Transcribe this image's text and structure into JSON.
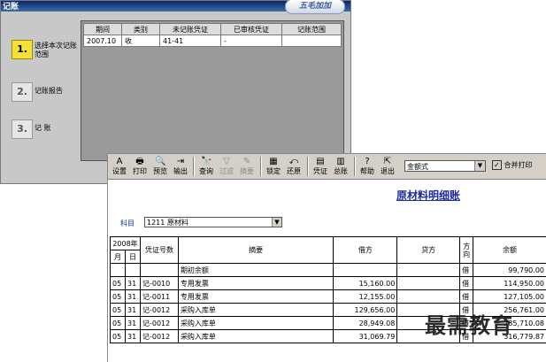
{
  "back_window": {
    "title": "记账",
    "logo_text": "五毛加加",
    "steps": [
      {
        "num": "1.",
        "label": "选择本次记账范围"
      },
      {
        "num": "2.",
        "label": "记账报告"
      },
      {
        "num": "3.",
        "label": "记    账"
      }
    ],
    "grid": {
      "headers": [
        "期间",
        "类别",
        "未记账凭证",
        "已审核凭证",
        "记账范围"
      ],
      "rows": [
        [
          "2007.10",
          "收",
          "41-41",
          "-",
          ""
        ]
      ]
    }
  },
  "toolbar": {
    "buttons": [
      {
        "label": "设置",
        "icon": "A"
      },
      {
        "label": "打印",
        "icon": "🖶"
      },
      {
        "label": "预览",
        "icon": "🔍"
      },
      {
        "label": "输出",
        "icon": "⇥"
      },
      {
        "label": "查询",
        "icon": "🔭"
      },
      {
        "label": "过滤",
        "icon": "▽"
      },
      {
        "label": "摘要",
        "icon": "✎"
      },
      {
        "label": "锁定",
        "icon": "▦"
      },
      {
        "label": "还原",
        "icon": "⤺"
      },
      {
        "label": "凭证",
        "icon": "▤"
      },
      {
        "label": "总账",
        "icon": "▥"
      },
      {
        "label": "帮助",
        "icon": "?"
      },
      {
        "label": "退出",
        "icon": "⇱"
      }
    ],
    "format_select": "金额式",
    "merge_print_label": "合并打印",
    "merge_print_checked": "✓"
  },
  "report": {
    "title": "原材料明细账",
    "subject_label": "科目",
    "subject_value": "1211  原材料"
  },
  "ledger": {
    "year_header": "2008年",
    "month_header": "月",
    "day_header": "日",
    "voucher_header": "凭证号数",
    "summary_header": "摘要",
    "debit_header": "借方",
    "credit_header": "贷方",
    "direction_header": "方向",
    "balance_header": "余额",
    "rows": [
      {
        "m": "",
        "d": "",
        "v": "",
        "s": "期初余额",
        "debit": "",
        "credit": "",
        "dir": "借",
        "bal": "99,790.00"
      },
      {
        "m": "05",
        "d": "31",
        "v": "记-0010",
        "s": "专用发票",
        "debit": "15,160.00",
        "credit": "",
        "dir": "借",
        "bal": "114,950.00"
      },
      {
        "m": "05",
        "d": "31",
        "v": "记-0011",
        "s": "专用发票",
        "debit": "12,155.00",
        "credit": "",
        "dir": "借",
        "bal": "127,105.00"
      },
      {
        "m": "05",
        "d": "31",
        "v": "记-0012",
        "s": "采购入库单",
        "debit": "129,656.00",
        "credit": "",
        "dir": "借",
        "bal": "256,761.00"
      },
      {
        "m": "05",
        "d": "31",
        "v": "记-0012",
        "s": "采购入库单",
        "debit": "28,949.08",
        "credit": "",
        "dir": "借",
        "bal": "285,710.08"
      },
      {
        "m": "05",
        "d": "31",
        "v": "记-0012",
        "s": "采购入库单",
        "debit": "31,069.79",
        "credit": "",
        "dir": "借",
        "bal": "316,779.87"
      }
    ]
  },
  "watermark": "最需教育"
}
